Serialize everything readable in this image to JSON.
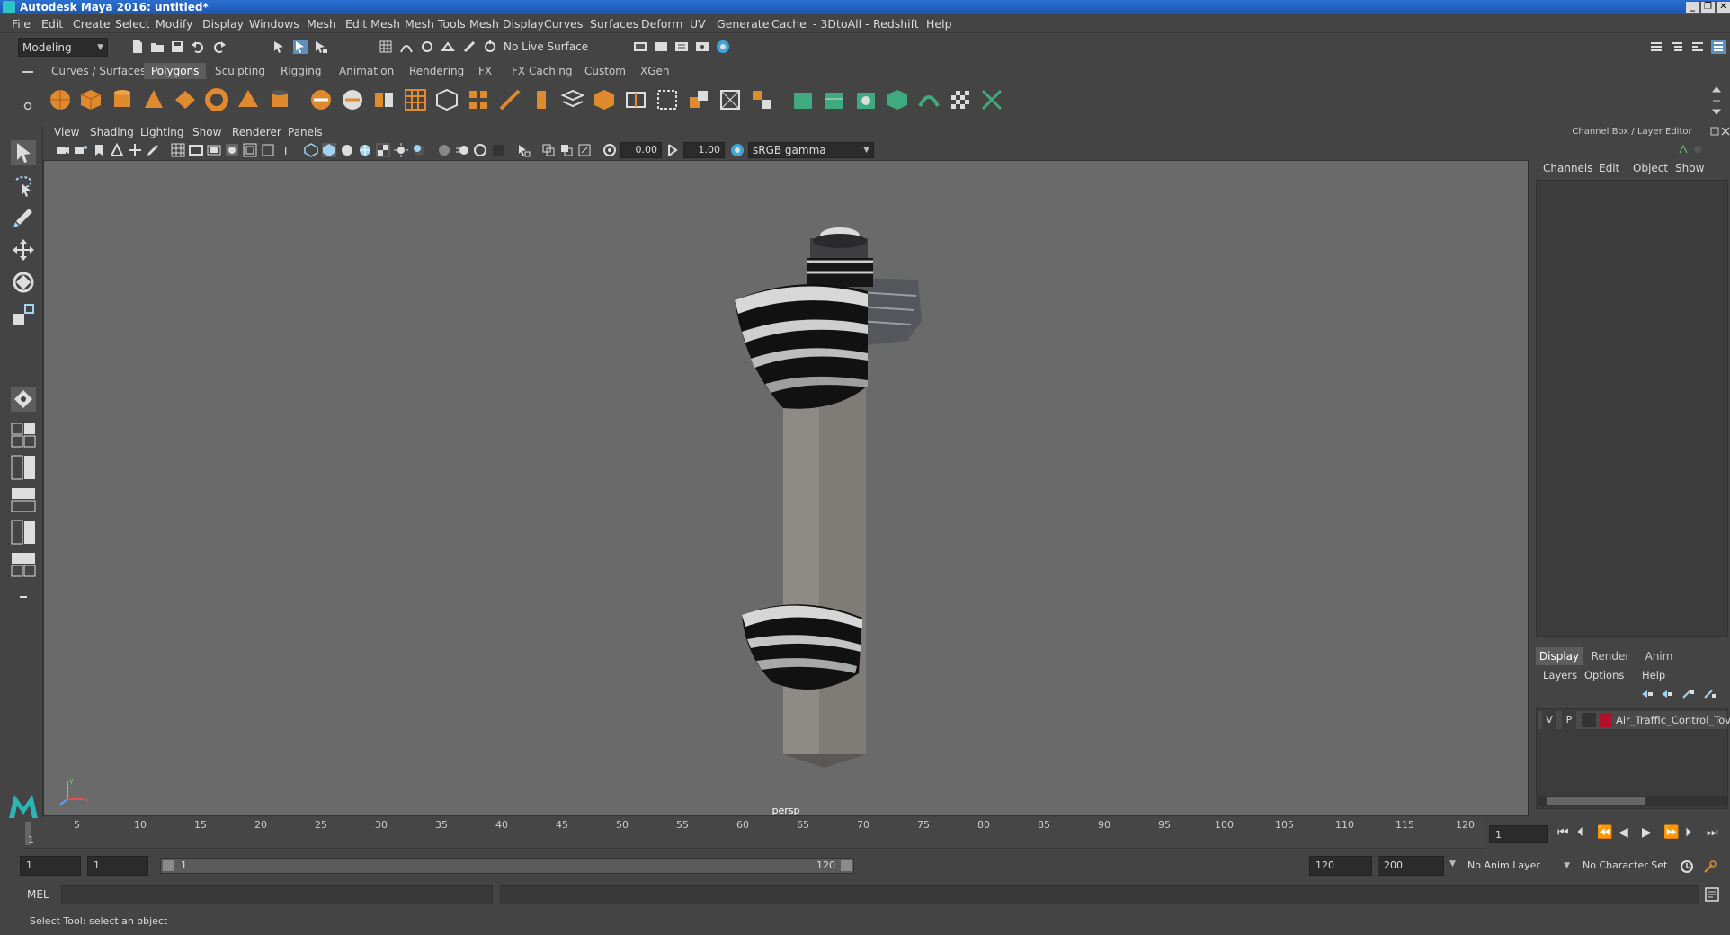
{
  "window": {
    "title": "Autodesk Maya 2016: untitled*"
  },
  "menubar": [
    "File",
    "Edit",
    "Create",
    "Select",
    "Modify",
    "Display",
    "Windows",
    "Mesh",
    "Edit Mesh",
    "Mesh Tools",
    "Mesh Display",
    "Curves",
    "Surfaces",
    "Deform",
    "UV",
    "Generate",
    "Cache",
    "- 3DtoAll -",
    "Redshift",
    "Help"
  ],
  "statusline": {
    "mode": "Modeling",
    "live_surface": "No Live Surface"
  },
  "shelf": {
    "tabs": [
      "Curves / Surfaces",
      "Polygons",
      "Sculpting",
      "Rigging",
      "Animation",
      "Rendering",
      "FX",
      "FX Caching",
      "Custom",
      "XGen"
    ],
    "active_tab": "Polygons"
  },
  "panel": {
    "menus": [
      "View",
      "Shading",
      "Lighting",
      "Show",
      "Renderer",
      "Panels"
    ],
    "exposure": "0.00",
    "gamma": "1.00",
    "colorspace": "sRGB gamma",
    "camera_label": "persp"
  },
  "channelbox": {
    "title": "Channel Box / Layer Editor",
    "menus": [
      "Channels",
      "Edit",
      "Object",
      "Show"
    ],
    "layer_tabs": [
      "Display",
      "Render",
      "Anim"
    ],
    "active_layer_tab": "Display",
    "layer_menus": [
      "Layers",
      "Options",
      "Help"
    ],
    "layer": {
      "v": "V",
      "p": "P",
      "name": "Air_Traffic_Control_Tov",
      "color": "#b0102a"
    }
  },
  "timeline": {
    "ticks": [
      "5",
      "10",
      "15",
      "20",
      "25",
      "30",
      "35",
      "40",
      "45",
      "50",
      "55",
      "60",
      "65",
      "70",
      "75",
      "80",
      "85",
      "90",
      "95",
      "100",
      "105",
      "110",
      "115",
      "120"
    ],
    "start_tick": "1",
    "current_frame": "1"
  },
  "range": {
    "start": "1",
    "playback_start": "1",
    "slider_start": "1",
    "slider_end": "120",
    "playback_end": "120",
    "end": "200",
    "anim_layer": "No Anim Layer",
    "character_set": "No Character Set"
  },
  "cmdline": {
    "label": "MEL"
  },
  "helpline": {
    "text": "Select Tool: select an object"
  }
}
